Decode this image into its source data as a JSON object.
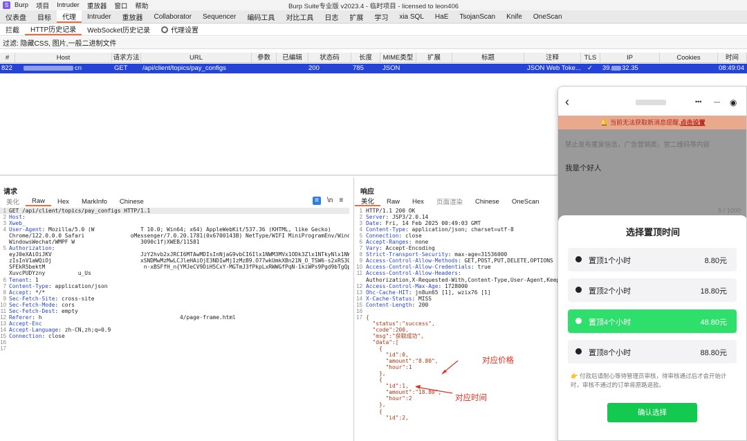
{
  "window": {
    "title": "Burp Suite专业版 v2023.4 - 临时项目 - licensed to leon406",
    "menu": [
      "Burp",
      "项目",
      "Intruder",
      "重放器",
      "窗口",
      "帮助"
    ]
  },
  "main_tabs": [
    "仪表盘",
    "目标",
    "代理",
    "Intruder",
    "重放器",
    "Collaborator",
    "Sequencer",
    "编码工具",
    "对比工具",
    "日志",
    "扩展",
    "学习",
    "xia SQL",
    "HaE",
    "TsojanScan",
    "Knife",
    "OneScan"
  ],
  "main_tab_active": "代理",
  "sub_tabs": [
    "拦截",
    "HTTP历史记录",
    "WebSocket历史记录",
    "代理设置"
  ],
  "filter_text": "过滤: 隐藏CSS, 图片,一般二进制文件",
  "table": {
    "columns": [
      "#",
      "Host",
      "请求方法",
      "URL",
      "参数",
      "已编辑",
      "状态码",
      "长度",
      "MIME类型",
      "扩展",
      "标题",
      "注释",
      "TLS",
      "IP",
      "Cookies",
      "时间"
    ],
    "row": {
      "num": "822",
      "host_suffix": "cn",
      "method": "GET",
      "url": "/api/client/topics/pay_configs",
      "status": "200",
      "length": "785",
      "mime": "JSON",
      "comment": "JSON Web Toke...",
      "tls": "✓",
      "ip_prefix": "39.",
      "ip_suffix": "32.35",
      "time": "08:49:04"
    }
  },
  "request": {
    "title": "请求",
    "tabs": [
      "美化",
      "Raw",
      "Hex",
      "MarkInfo",
      "Chinese"
    ],
    "active_tab": "Raw",
    "toolbar": [
      "≡",
      "\\n",
      "≡"
    ],
    "lines": [
      {
        "n": "1",
        "k": "",
        "v": "GET /api/client/topics/pay_configs HTTP/1.1"
      },
      {
        "n": "2",
        "k": "Host",
        "v": ": "
      },
      {
        "n": "3",
        "k": "Xweb_",
        "v": ""
      },
      {
        "n": "4",
        "k": "User-Agent",
        "v": ": Mozilla/5.0 (W              T 10.0; Win64; x64) AppleWebKit/537.36 (KHTML, like Gecko)"
      },
      {
        "n": "",
        "k": "",
        "v": "Chrome/122.0.0.0 Safari              oMessenger/7.0.20.1781(0x6700143B) NetType/WIFI MiniProgramEnv/Windows"
      },
      {
        "n": "",
        "k": "",
        "v": "WindowsWechat/WMPF W                    3090c1f)XWEB/11581"
      },
      {
        "n": "5",
        "k": "Authorization",
        "v": ":"
      },
      {
        "n": "",
        "k": "",
        "v": "eyJ0eXAiOiJKV                           JzY2hvb2xJRCI6MTAwMDIsInNjaG9vbCI6Ilx1NWM3MVx1ODk3Zlx1NTkyNlx1NWI2N"
      },
      {
        "n": "",
        "k": "",
        "v": "zIsInV1aWQiOj                           xSNDMwMzMwLCJleHAiOjE3NDIwMjIzMzB9.O77wkUmkXBn21N_O_TSW6-s2xRS3G5DOMz"
      },
      {
        "n": "",
        "k": "",
        "v": "SFEkR5bektM                              n-xBSFfH_n{YMJeCV9DiH5CxY-MGTmJ3fPkpLxRWWGfPqN-1kiWPs9Pgd9bTgQpOXAMm2LOO"
      },
      {
        "n": "",
        "k": "",
        "v": "XuvcPUDYzny          u_Us"
      },
      {
        "n": "6",
        "k": "Tenant",
        "v": ": 1"
      },
      {
        "n": "7",
        "k": "Content-Type",
        "v": ": application/json"
      },
      {
        "n": "8",
        "k": "Accept",
        "v": ": */*"
      },
      {
        "n": "9",
        "k": "Sec-Fetch-Site",
        "v": ": cross-site"
      },
      {
        "n": "10",
        "k": "Sec-Fetch-Mode",
        "v": ": cors"
      },
      {
        "n": "11",
        "k": "Sec-Fetch-Dest",
        "v": ": empty"
      },
      {
        "n": "12",
        "k": "Referer",
        "v": ": h                                          4/page-frame.html"
      },
      {
        "n": "13",
        "k": "Accept-Enc",
        "v": ""
      },
      {
        "n": "14",
        "k": "Accept-Language",
        "v": ": zh-CN,zh;q=0.9"
      },
      {
        "n": "15",
        "k": "Connection",
        "v": ": close"
      },
      {
        "n": "16",
        "k": "",
        "v": ""
      },
      {
        "n": "17",
        "k": "",
        "v": ""
      }
    ]
  },
  "response": {
    "title": "响应",
    "tabs": [
      "美化",
      "Raw",
      "Hex",
      "页面渲染",
      "Chinese",
      "OneScan"
    ],
    "active_tab": "美化",
    "lines": [
      {
        "n": "1",
        "k": "",
        "v": "HTTP/1.1 200 OK"
      },
      {
        "n": "2",
        "k": "Server",
        "v": ": JSP3/2.0.14"
      },
      {
        "n": "3",
        "k": "Date",
        "v": ": Fri, 14 Feb 2025 00:49:03 GMT"
      },
      {
        "n": "4",
        "k": "Content-Type",
        "v": ": application/json; charset=utf-8"
      },
      {
        "n": "5",
        "k": "Connection",
        "v": ": close"
      },
      {
        "n": "6",
        "k": "Accept-Ranges",
        "v": ": none"
      },
      {
        "n": "7",
        "k": "Vary",
        "v": ": Accept-Encoding"
      },
      {
        "n": "8",
        "k": "Strict-Transport-Security",
        "v": ": max-age=31536000"
      },
      {
        "n": "9",
        "k": "Access-Control-Allow-Methods",
        "v": ": GET,POST,PUT,DELETE,OPTIONS"
      },
      {
        "n": "10",
        "k": "Access-Control-Allow-Credentials",
        "v": ": true"
      },
      {
        "n": "11",
        "k": "Access-Control-Allow-Headers",
        "v": ":"
      },
      {
        "n": "",
        "k": "",
        "v": "Authorization,X-Requested-With,Content-Type,User-Agent,Keep-A"
      },
      {
        "n": "12",
        "k": "Access-Control-Max-Age",
        "v": ": 1728000"
      },
      {
        "n": "13",
        "k": "Ohc-Cache-HIT",
        "v": ": jn8un65 [1], wzix76 [1]"
      },
      {
        "n": "14",
        "k": "X-Cache-Status",
        "v": ": MISS"
      },
      {
        "n": "15",
        "k": "Content-Length",
        "v": ": 200"
      },
      {
        "n": "16",
        "k": "",
        "v": ""
      },
      {
        "n": "17",
        "k": "",
        "v": "{"
      },
      {
        "n": "",
        "k": "",
        "v": "  \"status\":\"success\","
      },
      {
        "n": "",
        "k": "",
        "v": "  \"code\":200,"
      },
      {
        "n": "",
        "k": "",
        "v": "  \"msg\":\"获取成功\","
      },
      {
        "n": "",
        "k": "",
        "v": "  \"data\":["
      },
      {
        "n": "",
        "k": "",
        "v": "    {"
      },
      {
        "n": "",
        "k": "",
        "v": "      \"id\":0,"
      },
      {
        "n": "",
        "k": "",
        "v": "      \"amount\":\"8.80\","
      },
      {
        "n": "",
        "k": "",
        "v": "      \"hour\":1"
      },
      {
        "n": "",
        "k": "",
        "v": "    },"
      },
      {
        "n": "",
        "k": "",
        "v": "    {"
      },
      {
        "n": "",
        "k": "",
        "v": "      \"id\":1,"
      },
      {
        "n": "",
        "k": "",
        "v": "      \"amount\":\"18.80\","
      },
      {
        "n": "",
        "k": "",
        "v": "      \"hour\":2"
      },
      {
        "n": "",
        "k": "",
        "v": "    },"
      },
      {
        "n": "",
        "k": "",
        "v": "    {"
      },
      {
        "n": "",
        "k": "",
        "v": "      \"id\":2,"
      }
    ]
  },
  "annotations": {
    "price": "对应价格",
    "time": "对应时间"
  },
  "phone": {
    "top_icons": [
      "‹",
      "•••",
      "—",
      "◉"
    ],
    "warning": "当前无法获取新消息提醒,",
    "warning_link": "点击设置",
    "notice": "禁止发布重复信息，广告营销类，宫二维码等内容",
    "post_text": "我是个好人",
    "counter": "5 / 1000",
    "sheet_title": "选择置顶时间",
    "options": [
      {
        "label": "置顶1个小时",
        "price": "8.80元",
        "selected": false
      },
      {
        "label": "置顶2个小时",
        "price": "18.80元",
        "selected": false
      },
      {
        "label": "置顶4个小时",
        "price": "48.80元",
        "selected": true
      },
      {
        "label": "置顶8个小时",
        "price": "88.80元",
        "selected": false
      }
    ],
    "tip": "付款后请耐心等待管理员审核，待审核通过后才会开始计时，审核不通过的订单将原路退款。",
    "confirm": "确认选择"
  },
  "colors": {
    "accent": "#ff6633",
    "selected_row": "#2544d6",
    "option_selected": "#2fdf6b",
    "confirm_button": "#14c94f",
    "annotation": "#e0301e"
  }
}
